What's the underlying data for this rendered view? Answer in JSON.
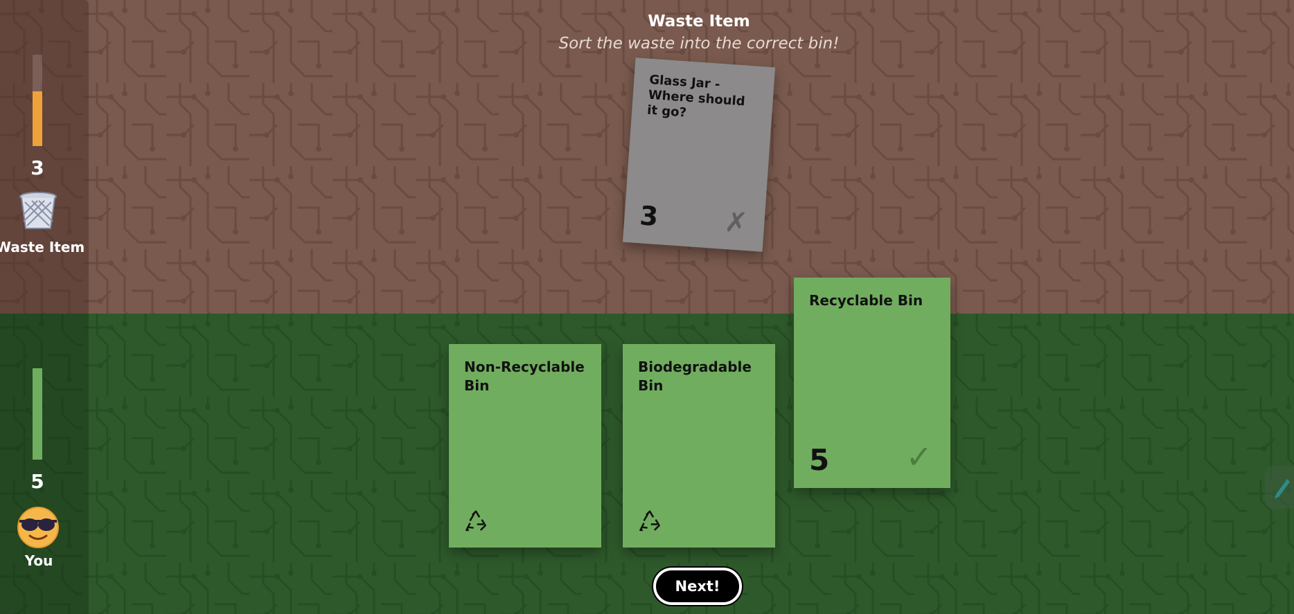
{
  "header": {
    "title": "Waste Item",
    "subtitle": "Sort the waste into the correct bin!"
  },
  "opponent": {
    "name": "Waste Item",
    "score": "3",
    "meter_fraction": 0.6,
    "meter_color": "#f0a23a",
    "icon": "wastebasket-icon"
  },
  "player": {
    "name": "You",
    "score": "5",
    "meter_fraction": 1.0,
    "meter_color": "#6fae5e",
    "icon": "sunglasses-emoji-icon"
  },
  "prompt_card": {
    "title": "Glass Jar - Where should it go?",
    "value": "3",
    "mark": "✗",
    "color": "#8c8a8b"
  },
  "bins": [
    {
      "title": "Non-Recyclable Bin",
      "icon": "recycle-icon",
      "color": "#71ad5f"
    },
    {
      "title": "Biodegradable Bin",
      "icon": "recycle-icon",
      "color": "#71ad5f"
    },
    {
      "title": "Recyclable Bin",
      "value": "5",
      "mark": "✓",
      "color": "#71ad5f",
      "selected": true
    }
  ],
  "actions": {
    "next_label": "Next!"
  },
  "colors": {
    "top_zone": "#7a5a4e",
    "bottom_zone": "#2e5a2b"
  }
}
